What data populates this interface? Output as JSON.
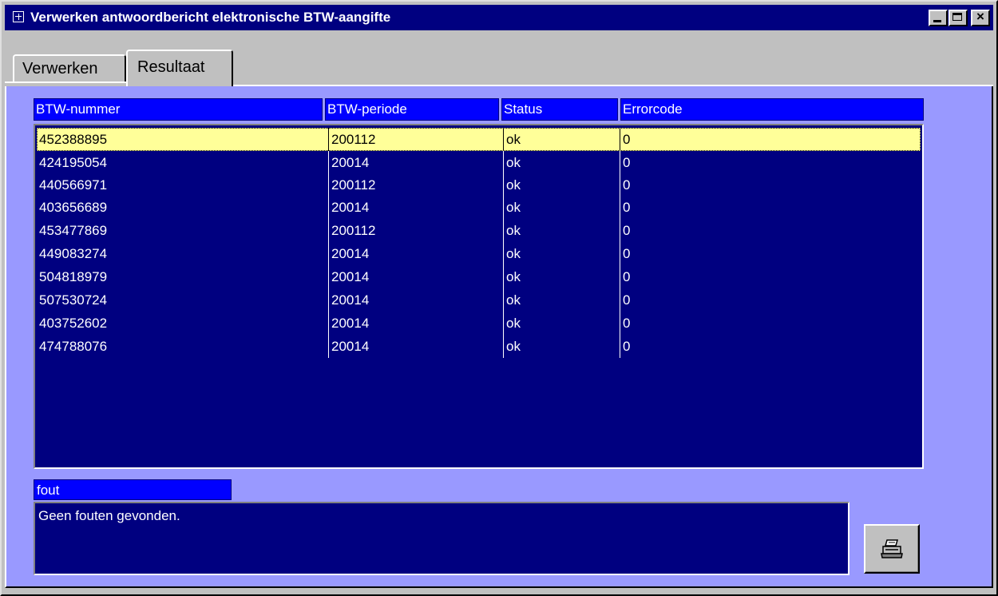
{
  "window": {
    "title": "Verwerken antwoordbericht elektronische BTW-aangifte",
    "controls": {
      "minimize": "_",
      "maximize": "□",
      "close": "×"
    }
  },
  "tabs": [
    {
      "label": "Verwerken",
      "active": false
    },
    {
      "label": "Resultaat",
      "active": true
    }
  ],
  "table": {
    "columns": [
      "BTW-nummer",
      "BTW-periode",
      "Status",
      "Errorcode"
    ],
    "rows": [
      [
        "452388895",
        "200112",
        "ok",
        "0"
      ],
      [
        "424195054",
        "20014",
        "ok",
        "0"
      ],
      [
        "440566971",
        "200112",
        "ok",
        "0"
      ],
      [
        "403656689",
        "20014",
        "ok",
        "0"
      ],
      [
        "453477869",
        "200112",
        "ok",
        "0"
      ],
      [
        "449083274",
        "20014",
        "ok",
        "0"
      ],
      [
        "504818979",
        "20014",
        "ok",
        "0"
      ],
      [
        "507530724",
        "20014",
        "ok",
        "0"
      ],
      [
        "403752602",
        "20014",
        "ok",
        "0"
      ],
      [
        "474788076",
        "20014",
        "ok",
        "0"
      ]
    ],
    "selected_row": 0
  },
  "fout": {
    "label": "fout",
    "value": "Geen fouten gevonden."
  },
  "print_button": {
    "icon": "printer-icon"
  },
  "colors": {
    "titlebar": "#000080",
    "panel": "#9999ff",
    "header": "#0000ff",
    "list_bg": "#000080",
    "selected_row": "#ffff99"
  }
}
